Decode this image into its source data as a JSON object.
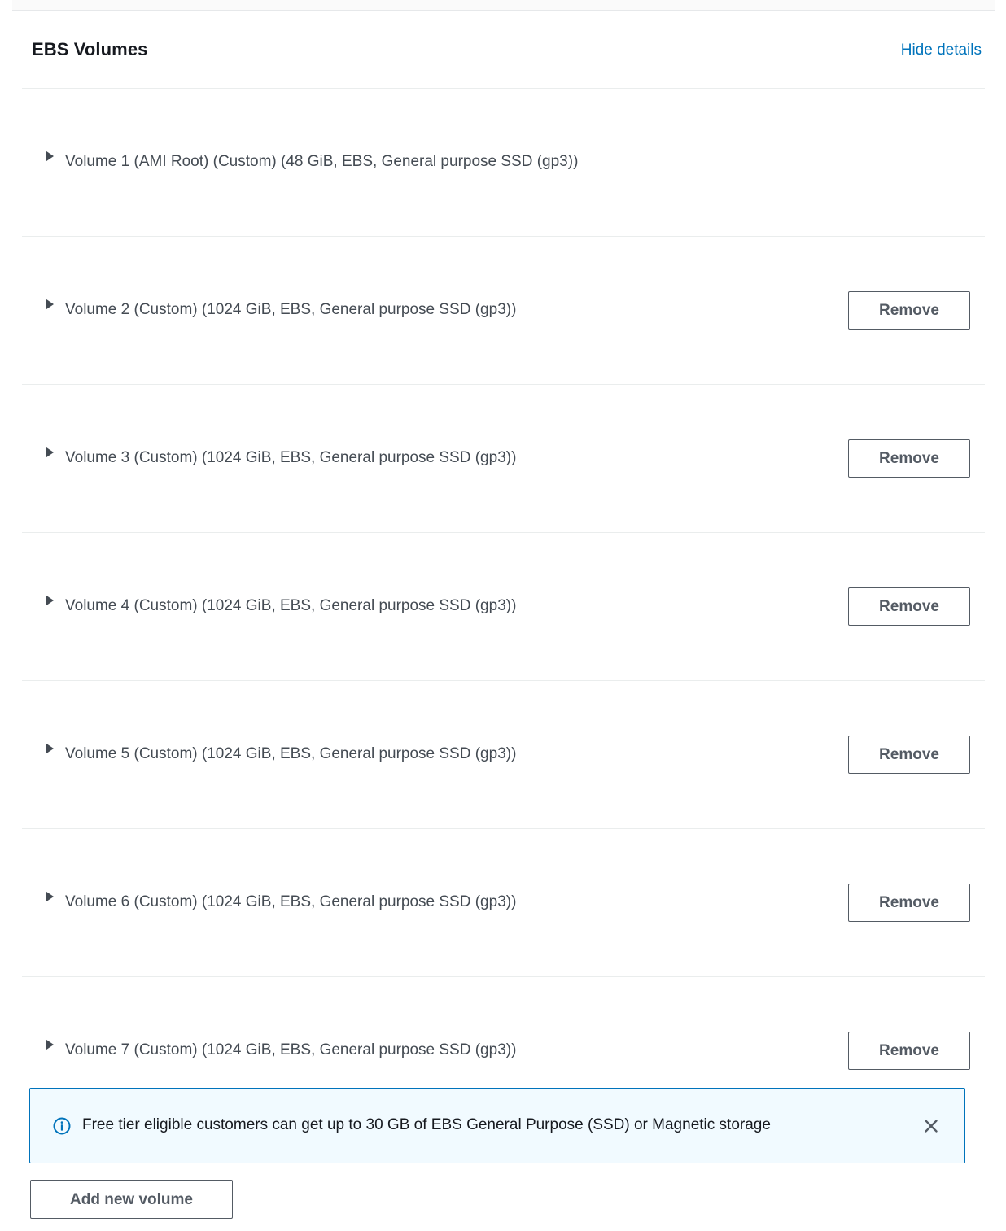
{
  "panel": {
    "title": "EBS Volumes",
    "hide_details_label": "Hide details",
    "accent_link_color": "#0073bb",
    "border_color": "#eaeded"
  },
  "volumes": [
    {
      "label": "Volume 1 (AMI Root) (Custom) (48 GiB, EBS, General purpose SSD (gp3))",
      "removable": false,
      "remove_label": "",
      "expanded": false,
      "disclosure_icon": "triangle-right-icon"
    },
    {
      "label": "Volume 2 (Custom) (1024 GiB, EBS, General purpose SSD (gp3))",
      "removable": true,
      "remove_label": "Remove",
      "expanded": false,
      "disclosure_icon": "triangle-right-icon"
    },
    {
      "label": "Volume 3 (Custom) (1024 GiB, EBS, General purpose SSD (gp3))",
      "removable": true,
      "remove_label": "Remove",
      "expanded": false,
      "disclosure_icon": "triangle-right-icon"
    },
    {
      "label": "Volume 4 (Custom) (1024 GiB, EBS, General purpose SSD (gp3))",
      "removable": true,
      "remove_label": "Remove",
      "expanded": false,
      "disclosure_icon": "triangle-right-icon"
    },
    {
      "label": "Volume 5 (Custom) (1024 GiB, EBS, General purpose SSD (gp3))",
      "removable": true,
      "remove_label": "Remove",
      "expanded": false,
      "disclosure_icon": "triangle-right-icon"
    },
    {
      "label": "Volume 6 (Custom) (1024 GiB, EBS, General purpose SSD (gp3))",
      "removable": true,
      "remove_label": "Remove",
      "expanded": false,
      "disclosure_icon": "triangle-right-icon"
    },
    {
      "label": "Volume 7 (Custom) (1024 GiB, EBS, General purpose SSD (gp3))",
      "removable": true,
      "remove_label": "Remove",
      "expanded": false,
      "disclosure_icon": "triangle-right-icon"
    }
  ],
  "info_banner": {
    "icon": "info-circle-icon",
    "text": "Free tier eligible customers can get up to 30 GB of EBS General Purpose (SSD) or Magnetic storage",
    "close_icon": "close-icon",
    "background_color": "#f1faff",
    "border_color": "#0073bb"
  },
  "footer": {
    "add_volume_label": "Add new volume"
  }
}
